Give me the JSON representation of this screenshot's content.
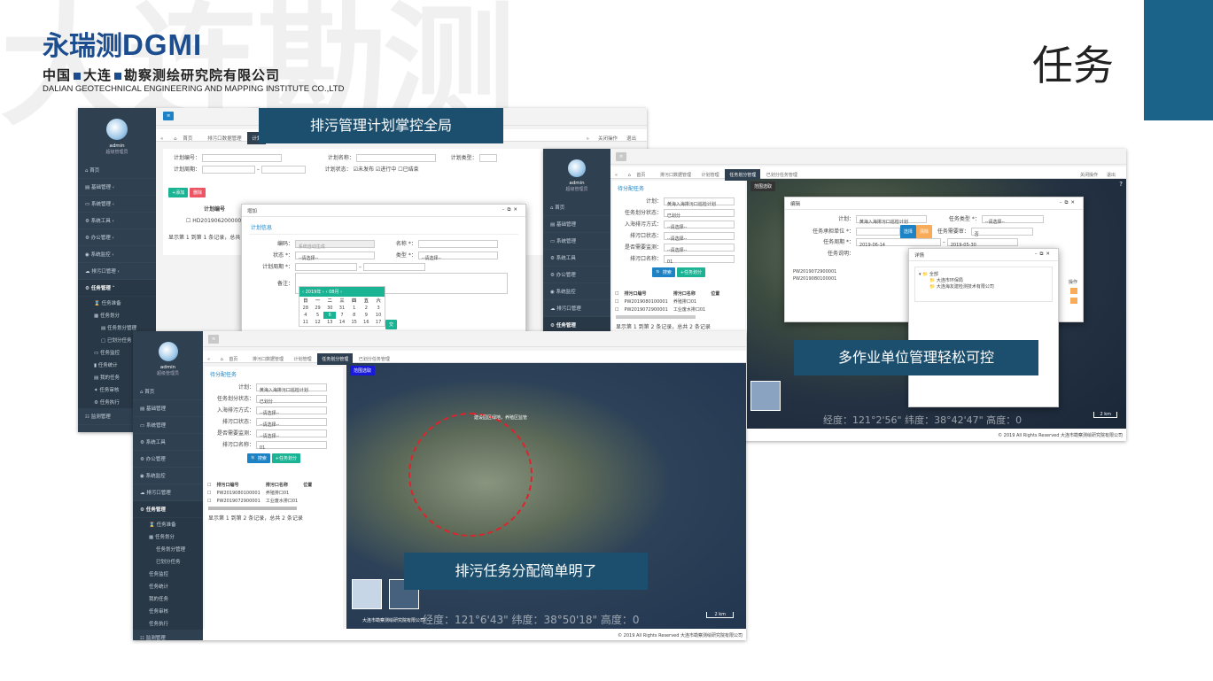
{
  "page": {
    "title": "任务",
    "watermark": "大连勘测",
    "logo": {
      "mark": "永瑞测",
      "brand": "DGMI",
      "cn_name": [
        "中国",
        "大连",
        "勘察测绘研究院有限公司"
      ],
      "en_name": "DALIAN GEOTECHNICAL ENGINEERING AND MAPPING INSTITUTE CO.,LTD"
    }
  },
  "captions": {
    "c1": "排污管理计划掌控全局",
    "c2": "多作业单位管理轻松可控",
    "c3": "排污任务分配简单明了"
  },
  "sidebar": {
    "user": "admin",
    "role": "超级管理员",
    "items": [
      "首页",
      "基础管理",
      "系统管理",
      "系统工具",
      "办公管理",
      "系统监控",
      "排污口管理",
      "任务管理"
    ],
    "task_subitems": [
      "任务准备",
      "任务划分",
      "任务划分管理",
      "已划分任务",
      "任务监控",
      "任务统计",
      "我的任务",
      "任务审核",
      "任务执行"
    ],
    "monitor": "监测管理"
  },
  "shot1": {
    "tabs": [
      "首页",
      "排污口数据管理",
      "计划"
    ],
    "tabs_right": [
      "关闭操作",
      "退出"
    ],
    "form": {
      "plan_no": "计划编号：",
      "plan_name": "计划名称：",
      "plan_type": "计划类型：",
      "plan_period": "计划周期：",
      "plan_status": "计划状态：",
      "status_opts": [
        "未发布",
        "进行中",
        "已结束"
      ],
      "select_ph": "--请选择"
    },
    "buttons": {
      "add": "+添加",
      "delete": "删除"
    },
    "table": {
      "col": "计划编号",
      "row": "HD2019062000001",
      "date": "9-30"
    },
    "footer": "显示第 1 到第 1 条记录，总共 1",
    "modal": {
      "title": "增加",
      "section": "计划信息",
      "fields": {
        "code": "编码：",
        "code_ph": "系统自动生成",
        "name": "名称 *：",
        "status": "状态 *：",
        "type": "类型 *：",
        "period": "计划周期 *：",
        "remark": "备注：",
        "select_ph": "--请选择--"
      },
      "calendar": {
        "year": "2019年",
        "month": "08月",
        "weekdays": [
          "日",
          "一",
          "二",
          "三",
          "四",
          "五",
          "六"
        ],
        "rows": [
          [
            "28",
            "29",
            "30",
            "31",
            "1",
            "2",
            "3"
          ],
          [
            "4",
            "5",
            "6",
            "7",
            "8",
            "9",
            "10"
          ],
          [
            "11",
            "12",
            "13",
            "14",
            "15",
            "16",
            "17"
          ]
        ],
        "today": "6",
        "submit": "交"
      }
    }
  },
  "shot2": {
    "tabs": [
      "首页",
      "排污口数据管理",
      "计划管理",
      "任务划分管理",
      "已划分任务管理"
    ],
    "tabs_right": [
      "关闭操作",
      "退出"
    ],
    "panel_title": "待分配任务",
    "fields": [
      {
        "label": "计划：",
        "value": "黄海入海排污口巡检计划"
      },
      {
        "label": "任务划分状态：",
        "value": "已划分"
      },
      {
        "label": "入海排污方式：",
        "value": "--请选择--"
      },
      {
        "label": "排污口状态：",
        "value": "--请选择--"
      },
      {
        "label": "是否需要监测：",
        "value": "--请选择--"
      },
      {
        "label": "排污口名称：",
        "value": "01"
      }
    ],
    "buttons": {
      "search": "搜索",
      "assign": "任务划分"
    },
    "table": {
      "cols": [
        "排污口编号",
        "排污口名称",
        "位置"
      ],
      "rows": [
        [
          "PW2019080100001",
          "养殖排口01"
        ],
        [
          "PW2019072900001",
          "工业废水排口01"
        ]
      ]
    },
    "footer": "显示第 1 到第 2 条记录，总共 2 条记录",
    "map_badge": "范围选取",
    "modal": {
      "title": "编辑",
      "fields": {
        "plan": "计划：",
        "plan_val": "黄海入海排污口巡检计划",
        "task_type": "任务类型 *：",
        "unit": "任务承担单位 *：",
        "pick": "选择",
        "clear": "清除",
        "need": "任务需要审：",
        "need_val": "否",
        "period": "任务周期 *：",
        "date_from": "2019-06-14",
        "date_to": "2019-05-30",
        "desc": "任务说明：",
        "select_ph": "--请选择--"
      },
      "table": {
        "rows": [
          "PW2019072900001",
          "PW2019080100001"
        ],
        "ops": "操作"
      }
    },
    "tree": {
      "title": "详情",
      "root": "全部",
      "nodes": [
        "大连市环保局",
        "大连海友建检测技术有限公司"
      ]
    },
    "coords": "经度：121°2'56\"    纬度：38°42'47\"    高度：0",
    "scale": "2 km",
    "copyright": "© 2019 All Rights Reserved 大连市勘察测绘研究院有限公司"
  },
  "shot3": {
    "tabs": [
      "首页",
      "排污口数据管理",
      "计划管理",
      "任务划分管理",
      "已划分任务管理"
    ],
    "panel_title": "待分配任务",
    "fields": [
      {
        "label": "计划：",
        "value": "黄海入海排污口巡检计划"
      },
      {
        "label": "任务划分状态：",
        "value": "已划分"
      },
      {
        "label": "入海排污方式：",
        "value": "--请选择--"
      },
      {
        "label": "排污口状态：",
        "value": "--请选择--"
      },
      {
        "label": "是否需要监测：",
        "value": "--请选择--"
      },
      {
        "label": "排污口名称：",
        "value": "01"
      }
    ],
    "buttons": {
      "search": "搜索",
      "assign": "任务划分"
    },
    "table": {
      "cols": [
        "排污口编号",
        "排污口名称",
        "位置"
      ],
      "rows": [
        [
          "PW2019080100001",
          "养殖排口01"
        ],
        [
          "PW2019072900001",
          "工业废水排口01"
        ]
      ]
    },
    "footer": "显示第 1 到第 2 条记录，总共 2 条记录",
    "map_badge": "范围选取",
    "map_label": "建设园区绿地，养殖区监管",
    "coords": "经度：121°6'43\"    纬度：38°50'18\"    高度：0",
    "scale": "2 km",
    "map_credit": "大连市勘察测绘研究院有限公司",
    "copyright": "© 2019 All Rights Reserved 大连市勘察测绘研究院有限公司"
  },
  "colors": {
    "accent": "#1c4f6e",
    "sidebar": "#2f4050",
    "teal": "#1ab394",
    "blue": "#1c84c6",
    "red": "#ed5565",
    "orange": "#f8ac59"
  }
}
